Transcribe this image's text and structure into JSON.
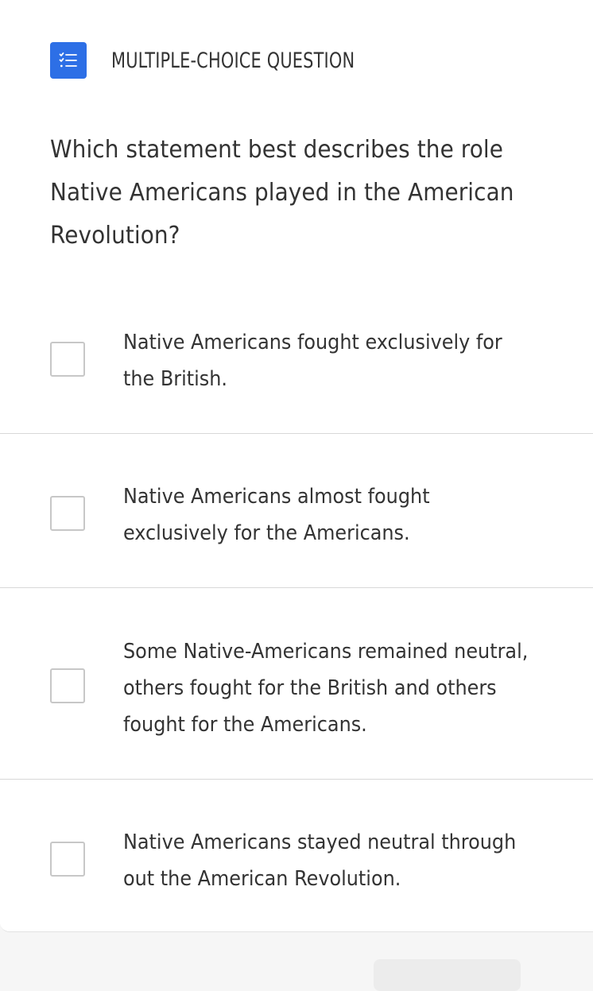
{
  "question_type": {
    "icon": "checklist-icon",
    "label": "MULTIPLE-CHOICE QUESTION"
  },
  "question": {
    "text": "Which statement best describes the role Native Americans played in the American Revolution?"
  },
  "options": [
    {
      "text": "Native Americans fought exclusively for the British.",
      "checked": false
    },
    {
      "text": "Native Americans almost fought exclusively for the Americans.",
      "checked": false
    },
    {
      "text": "Some Native-Americans remained neutral, others fought for the British and others fought for the Americans.",
      "checked": false
    },
    {
      "text": "Native Americans stayed neutral through out the American Revolution.",
      "checked": false
    }
  ],
  "colors": {
    "accent": "#2d6fe6",
    "text": "#333333",
    "divider": "#d8d8d8",
    "checkbox_border": "#c7c7c7"
  }
}
